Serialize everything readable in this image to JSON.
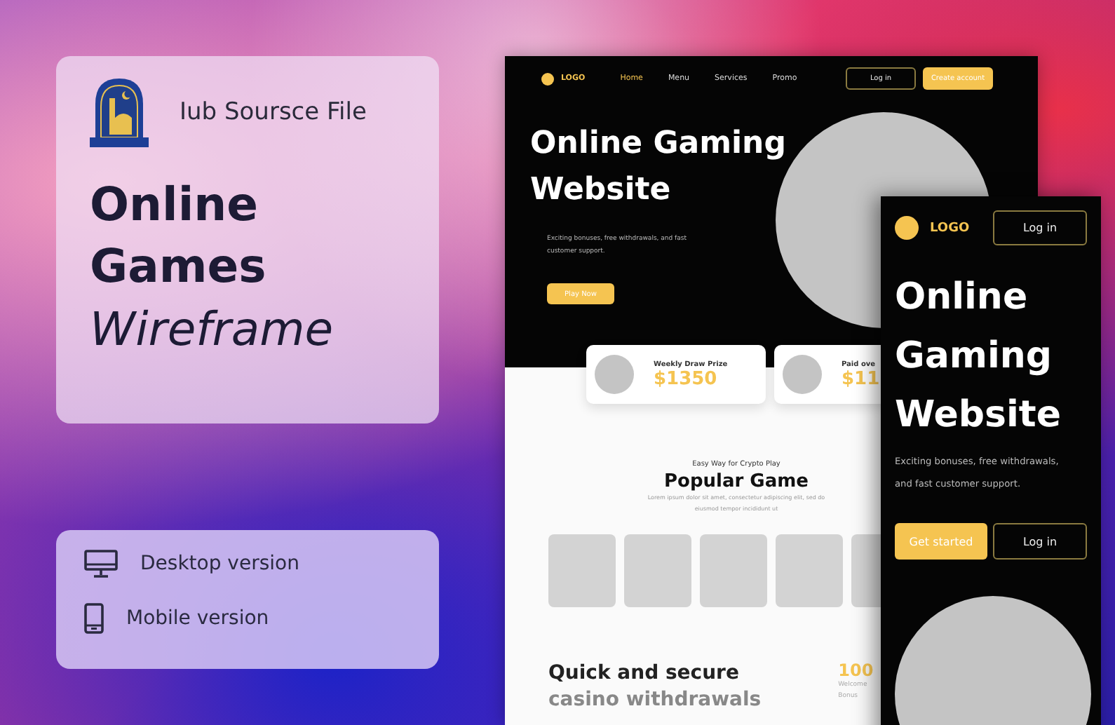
{
  "source": {
    "title": "Iub Soursce File"
  },
  "headline": {
    "lines": [
      "Online",
      "Games"
    ],
    "accent": "Wireframe"
  },
  "versions": [
    {
      "label": "Desktop version",
      "kind": "desktop"
    },
    {
      "label": "Mobile version",
      "kind": "mobile"
    }
  ],
  "desktop_mockup": {
    "logo": "LOGO",
    "nav": [
      {
        "label": "Home",
        "selected": true
      },
      {
        "label": "Menu",
        "selected": false
      },
      {
        "label": "Services",
        "selected": false
      },
      {
        "label": "Promo",
        "selected": false
      }
    ],
    "login": "Log in",
    "signup": "Create account",
    "title_lines": [
      "Online Gaming",
      "Website"
    ],
    "subtitle_lines": [
      "Exciting bonuses, free withdrawals, and fast",
      "customer support."
    ],
    "cta": "Play Now",
    "prizes": [
      {
        "label": "Weekly Draw Prize",
        "amount": "$1350"
      },
      {
        "label": "Paid ove",
        "amount": "$11"
      }
    ],
    "popular": {
      "eyebrow": "Easy Way for Crypto Play",
      "title": "Popular Game",
      "text_lines": [
        "Lorem ipsum dolor sit amet, consectetur adipiscing elit, sed do",
        "eiusmod tempor incididunt ut"
      ]
    },
    "withdrawals": {
      "title_lines": [
        "Quick and secure",
        "casino withdrawals"
      ],
      "stat": "100",
      "stat_lines": [
        "Welcome",
        "Bonus"
      ]
    }
  },
  "mobile_mockup": {
    "logo": "LOGO",
    "login": "Log in",
    "title_lines": [
      "Online",
      "Gaming",
      "Website"
    ],
    "subtitle_lines": [
      "Exciting bonuses, free withdrawals,",
      "and fast customer support."
    ],
    "primary": "Get started",
    "secondary": "Log in"
  }
}
